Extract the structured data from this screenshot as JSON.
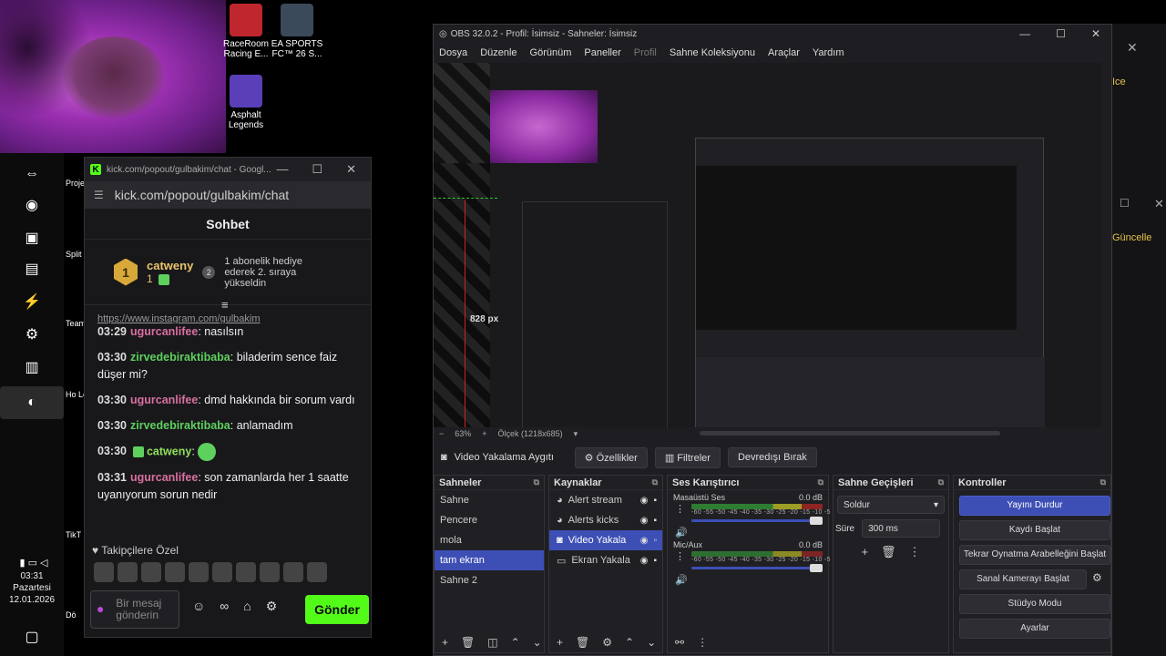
{
  "desktop": {
    "icons": [
      {
        "label": "RaceRoom Racing E..."
      },
      {
        "label": "EA SPORTS FC™ 26 S..."
      },
      {
        "label": "Asphalt Legends"
      }
    ],
    "col2_labels": [
      "Proje - Pag",
      "Split",
      "Team",
      "Ho Le",
      "TikT St",
      "Dö"
    ]
  },
  "taskbar": {
    "clock_time": "03:31",
    "clock_day": "Pazartesi",
    "clock_date": "12.01.2026"
  },
  "kick": {
    "window_title": "kick.com/popout/gulbakim/chat - Googl...",
    "url": "kick.com/popout/gulbakim/chat",
    "chat_title": "Sohbet",
    "pinned": {
      "user": "catweny",
      "count": "1",
      "rank": "2",
      "text": "1 abonelik hediye ederek 2. sıraya yükseldin"
    },
    "partial_link": "https://www.instagram.com/gulbakim",
    "messages": [
      {
        "time": "03:29",
        "user": "ugurcanlifee",
        "text": ": nasılsın"
      },
      {
        "time": "03:30",
        "user": "zirvedebiraktibaba",
        "text": ": biladerim sence faiz düşer mi?"
      },
      {
        "time": "03:30",
        "user": "ugurcanlifee",
        "text": ": dmd hakkında bir sorum vardı"
      },
      {
        "time": "03:30",
        "user": "zirvedebiraktibaba",
        "text": ": anlamadım"
      },
      {
        "time": "03:30",
        "user": "catweny",
        "text": ":"
      },
      {
        "time": "03:31",
        "user": "ugurcanlifee",
        "text": ": son zamanlarda her 1 saatte uyanıyorum sorun nedir"
      }
    ],
    "followers_label": "Takipçilere Özel",
    "input_placeholder": "Bir mesaj gönderin",
    "send_label": "Gönder"
  },
  "obs": {
    "title": "OBS 32.0.2 - Profil: İsimsiz - Sahneler: İsimsiz",
    "menu": [
      "Dosya",
      "Düzenle",
      "Görünüm",
      "Paneller",
      "Profil",
      "Sahne Koleksiyonu",
      "Araçlar",
      "Yardım"
    ],
    "px_label": "828 px",
    "zoom": "63%",
    "scale_label": "Ölçek (1218x685)",
    "source_name": "Video Yakalama Aygıtı",
    "btn_properties": "Özellikler",
    "btn_filters": "Filtreler",
    "btn_deactivate": "Devredışı Bırak",
    "scenes_title": "Sahneler",
    "scenes": [
      "Sahne",
      "Pencere",
      "mola",
      "tam ekran",
      "Sahne 2"
    ],
    "scene_selected": "tam ekran",
    "sources_title": "Kaynaklar",
    "sources": [
      "Alert stream",
      "Alerts kicks",
      "Video Yakala",
      "Ekran Yakala"
    ],
    "mixer_title": "Ses Karıştırıcı",
    "mixer": [
      {
        "name": "Masaüstü Ses",
        "db": "0.0 dB"
      },
      {
        "name": "Mic/Aux",
        "db": "0.0 dB"
      }
    ],
    "mixer_scale": "-60 -55 -50 -45 -40 -35 -30 -25 -20 -15 -10 -5 0",
    "transitions_title": "Sahne Geçişleri",
    "transition_value": "Soldur",
    "duration_label": "Süre",
    "duration_value": "300 ms",
    "controls_title": "Kontroller",
    "controls": [
      "Yayını Durdur",
      "Kaydı Başlat",
      "Tekrar Oynatma Arabelleğini Başlat",
      "Sanal Kamerayı Başlat",
      "Stüdyo Modu",
      "Ayarlar"
    ]
  },
  "background": {
    "update_label_1": "Ice",
    "update_label_2": "Güncelle"
  },
  "colors": {
    "kick_green": "#53fc18",
    "obs_accent": "#3d4fb5"
  }
}
